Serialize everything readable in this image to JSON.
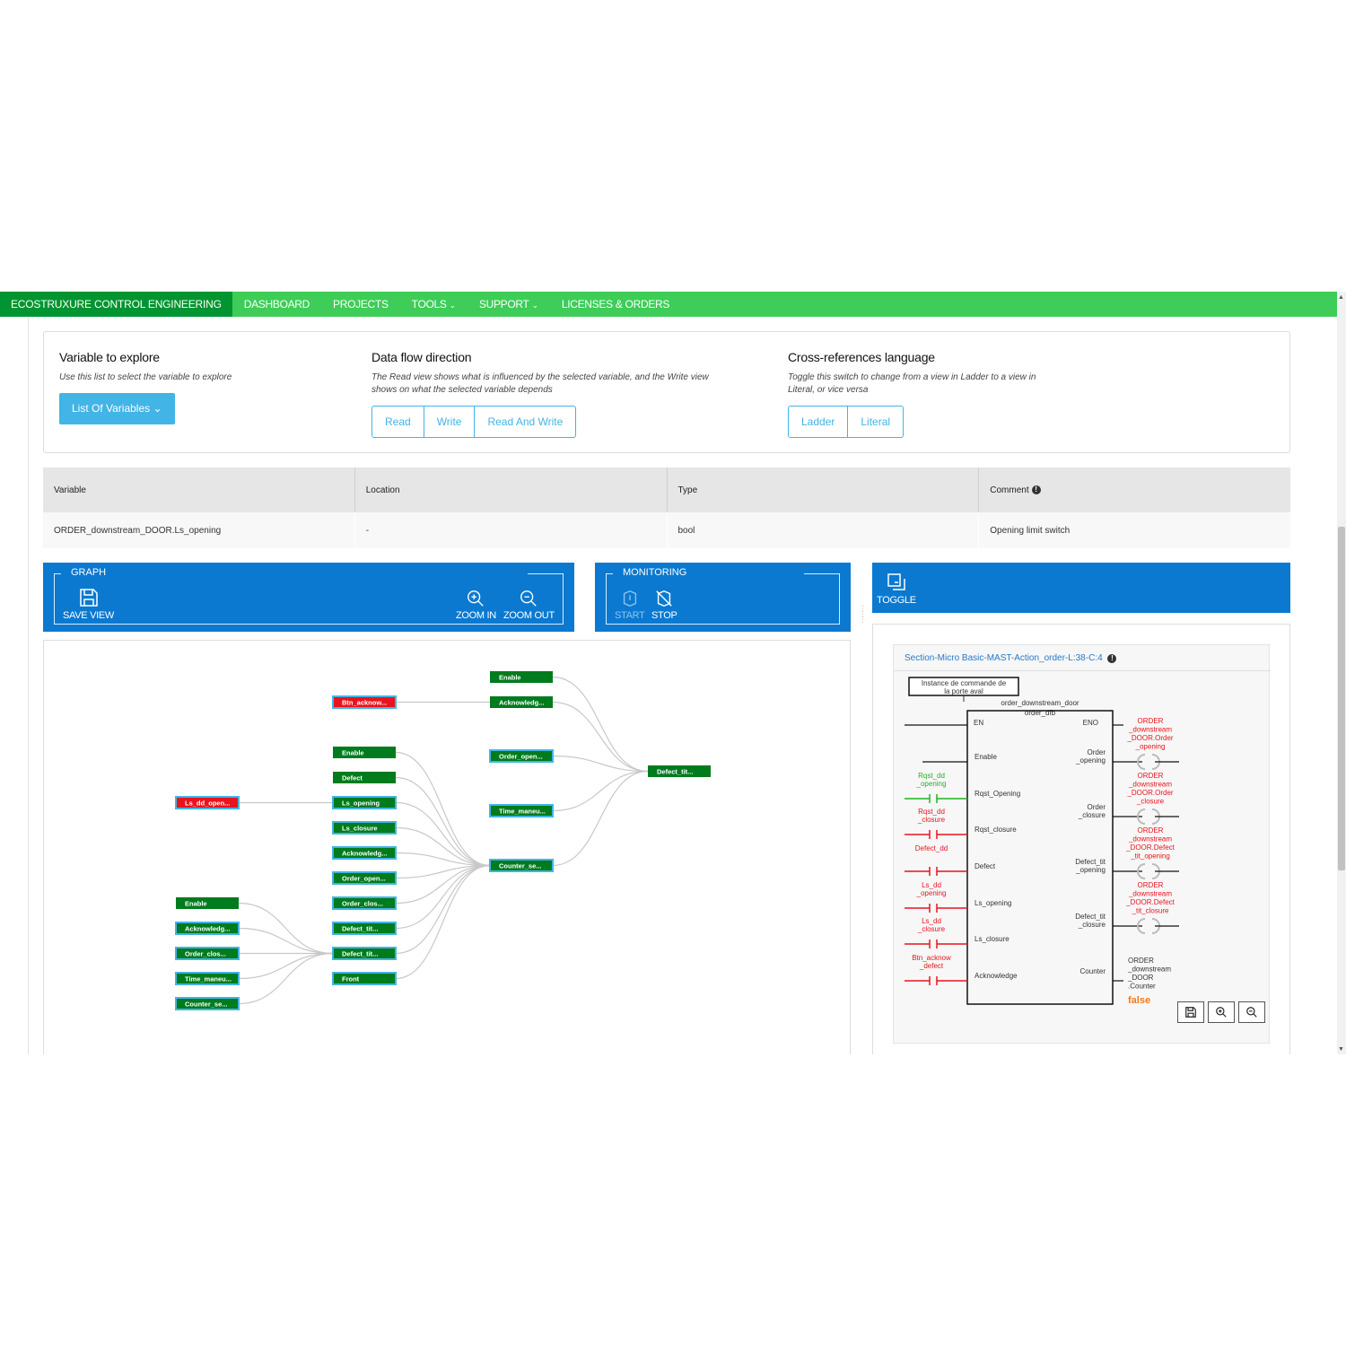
{
  "nav": {
    "brand": "ECOSTRUXURE CONTROL ENGINEERING",
    "items": [
      {
        "label": "DASHBOARD",
        "caret": ""
      },
      {
        "label": "PROJECTS",
        "caret": ""
      },
      {
        "label": "TOOLS",
        "caret": "⌄"
      },
      {
        "label": "SUPPORT",
        "caret": "⌄"
      },
      {
        "label": "LICENSES & ORDERS",
        "caret": ""
      }
    ]
  },
  "explore": {
    "title": "Variable to explore",
    "desc": "Use this list to select the variable to explore",
    "button": "List Of Variables ⌄"
  },
  "flow": {
    "title": "Data flow direction",
    "desc1": "The Read view shows what is influenced by the selected variable, and the Write view",
    "desc2": "shows on what the selected variable depends",
    "buttons": [
      "Read",
      "Write",
      "Read And Write"
    ]
  },
  "xref": {
    "title": "Cross-references language",
    "desc1": "Toggle this switch to change from a view in Ladder to a view in",
    "desc2": "Literal, or vice versa",
    "buttons": [
      "Ladder",
      "Literal"
    ]
  },
  "table": {
    "headers": [
      "Variable",
      "Location",
      "Type",
      "Comment"
    ],
    "row": [
      "ORDER_downstream_DOOR.Ls_opening",
      "-",
      "bool",
      "Opening limit switch"
    ]
  },
  "graph_toolbar": {
    "label": "GRAPH",
    "save": "SAVE VIEW",
    "zoom_in": "ZOOM IN",
    "zoom_out": "ZOOM OUT"
  },
  "monitoring": {
    "label": "MONITORING",
    "start": "START",
    "stop": "STOP"
  },
  "toggle": {
    "label": "TOGGLE"
  },
  "colors": {
    "nav": "#3dcd58",
    "brand": "#009530",
    "toolbar": "#0b79d0",
    "accent": "#42b4e6",
    "node_green": "#007b1d",
    "node_red": "#e8141d",
    "node_border": "#42b4e6"
  },
  "graph": {
    "nodes": [
      {
        "id": "n1",
        "label": "Enable",
        "color": "green",
        "border": false
      },
      {
        "id": "n2",
        "label": "Acknowledg...",
        "color": "green",
        "border": false
      },
      {
        "id": "n3",
        "label": "Btn_acknow...",
        "color": "red",
        "border": true
      },
      {
        "id": "n4",
        "label": "Order_open...",
        "color": "green",
        "border": true
      },
      {
        "id": "n5",
        "label": "Defect_tit...",
        "color": "green",
        "border": false
      },
      {
        "id": "n6",
        "label": "Enable",
        "color": "green",
        "border": false
      },
      {
        "id": "n7",
        "label": "Defect",
        "color": "green",
        "border": false
      },
      {
        "id": "n8",
        "label": "Ls_dd_open...",
        "color": "red",
        "border": true
      },
      {
        "id": "n9",
        "label": "Ls_opening",
        "color": "green",
        "border": true
      },
      {
        "id": "n10",
        "label": "Time_maneu...",
        "color": "green",
        "border": true
      },
      {
        "id": "n11",
        "label": "Ls_closure",
        "color": "green",
        "border": true
      },
      {
        "id": "n12",
        "label": "Acknowledg...",
        "color": "green",
        "border": true
      },
      {
        "id": "n13",
        "label": "Counter_se...",
        "color": "green",
        "border": true
      },
      {
        "id": "n14",
        "label": "Order_open...",
        "color": "green",
        "border": true
      },
      {
        "id": "n15",
        "label": "Order_clos...",
        "color": "green",
        "border": true
      },
      {
        "id": "n16",
        "label": "Enable",
        "color": "green",
        "border": false
      },
      {
        "id": "n17",
        "label": "Defect_tit...",
        "color": "green",
        "border": true
      },
      {
        "id": "n18",
        "label": "Acknowledg...",
        "color": "green",
        "border": true
      },
      {
        "id": "n19",
        "label": "Order_clos...",
        "color": "green",
        "border": true
      },
      {
        "id": "n20",
        "label": "Defect_tit...",
        "color": "green",
        "border": true
      },
      {
        "id": "n21",
        "label": "Time_maneu...",
        "color": "green",
        "border": true
      },
      {
        "id": "n22",
        "label": "Front",
        "color": "green",
        "border": true
      },
      {
        "id": "n23",
        "label": "Counter_se...",
        "color": "green",
        "border": true
      }
    ]
  },
  "ladder": {
    "title": "Section-Micro Basic-MAST-Action_order-L:38-C:4",
    "comment_box": "Instance de commande de la porte aval",
    "instance": "order_downstream_door",
    "block_type": "order_dfb",
    "en": "EN",
    "eno": "ENO",
    "inputs": [
      "Enable",
      "Rqst_Opening",
      "Rqst_closure",
      "Defect",
      "Ls_opening",
      "Ls_closure",
      "Acknowledge"
    ],
    "input_vars": [
      "Rqst_dd\n_opening",
      "Rqst_dd\n_closure",
      "Defect_dd",
      "Ls_dd\n_opening",
      "Ls_dd\n_closure",
      "Btn_acknow\n_defect"
    ],
    "outputs": [
      "Order\n_opening",
      "Order\n_closure",
      "Defect_tit\n_opening",
      "Defect_tit\n_closure",
      "Counter"
    ],
    "output_vars": [
      "ORDER\n_downstream\n_DOOR.Order\n_opening",
      "ORDER\n_downstream\n_DOOR.Order\n_closure",
      "ORDER\n_downstream\n_DOOR.Defect\n_tit_opening",
      "ORDER\n_downstream\n_DOOR.Defect\n_tit_closure",
      "ORDER\n_downstream\n_DOOR\n.Counter"
    ],
    "counter_value": "false"
  }
}
